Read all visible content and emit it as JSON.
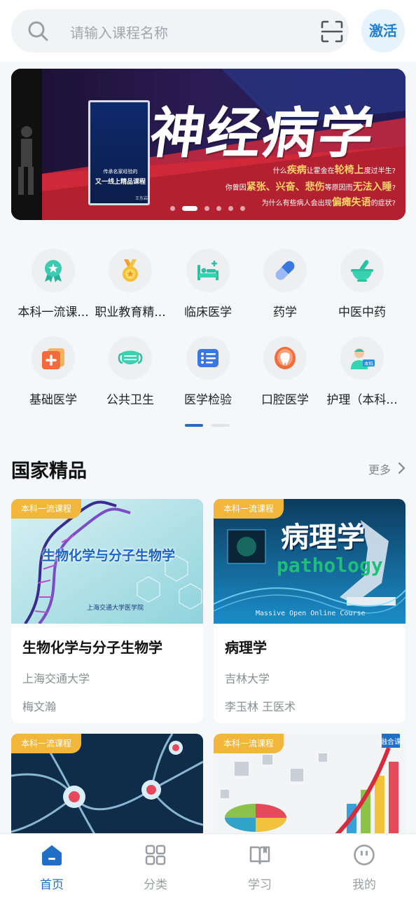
{
  "search": {
    "placeholder": "请输入课程名称",
    "icon": "search-icon",
    "scan_icon": "scan-icon"
  },
  "activate_label": "激活",
  "banner": {
    "title": "神经病学",
    "book_line1": "传承名家经验的",
    "book_line2": "又一线上精品课程",
    "book_author": "王东岩",
    "line1_a": "什么",
    "line1_hl1": "疾病",
    "line1_b": "让霍金在",
    "line1_hl2": "轮椅上",
    "line1_c": "度过半生?",
    "line2_a": "你曾因",
    "line2_hl1": "紧张、兴奋、悲伤",
    "line2_b": "等原因而",
    "line2_hl2": "无法入睡",
    "line2_c": "?",
    "line3_a": "为什么有些病人会出现",
    "line3_hl": "偏瘫失语",
    "line3_b": "的症状?",
    "slide_count": 6,
    "active_slide": 1
  },
  "categories": [
    {
      "label": "本科一流课...",
      "icon": "award-badge-icon"
    },
    {
      "label": "职业教育精...",
      "icon": "medal-icon"
    },
    {
      "label": "临床医学",
      "icon": "hospital-bed-icon"
    },
    {
      "label": "药学",
      "icon": "capsule-icon"
    },
    {
      "label": "中医中药",
      "icon": "mortar-pestle-icon"
    },
    {
      "label": "基础医学",
      "icon": "first-aid-kit-icon"
    },
    {
      "label": "公共卫生",
      "icon": "face-mask-icon"
    },
    {
      "label": "医学检验",
      "icon": "test-list-icon"
    },
    {
      "label": "口腔医学",
      "icon": "tooth-icon"
    },
    {
      "label": "护理（本科...",
      "icon": "nurse-icon"
    }
  ],
  "categories_pages": 2,
  "categories_active_page": 1,
  "section": {
    "title": "国家精品",
    "more": "更多"
  },
  "courses": [
    {
      "tag": "本科一流课程",
      "title": "生物化学与分子生物学",
      "university": "上海交通大学",
      "teachers": "梅文瀚",
      "thumb_title": "生物化学与分子生物学",
      "thumb_school": "上海交通大学医学院"
    },
    {
      "tag": "本科一流课程",
      "title": "病理学",
      "university": "吉林大学",
      "teachers": "李玉林 王医术",
      "thumb_title": "病理学",
      "thumb_sub": "pathology",
      "thumb_mooc": "Massive Open Online Course"
    },
    {
      "tag": "本科一流课程",
      "title": "",
      "university": "",
      "teachers": ""
    },
    {
      "tag": "本科一流课程",
      "title": "",
      "university": "",
      "teachers": "",
      "thumb_badge": "融合课"
    }
  ],
  "nav": [
    {
      "label": "首页",
      "icon": "home-icon",
      "active": true
    },
    {
      "label": "分类",
      "icon": "grid-icon",
      "active": false
    },
    {
      "label": "学习",
      "icon": "book-icon",
      "active": false
    },
    {
      "label": "我的",
      "icon": "profile-icon",
      "active": false
    }
  ],
  "colors": {
    "accent": "#1f6fc5",
    "tag": "#f2b73a",
    "activate_bg": "#e6f2fc"
  }
}
